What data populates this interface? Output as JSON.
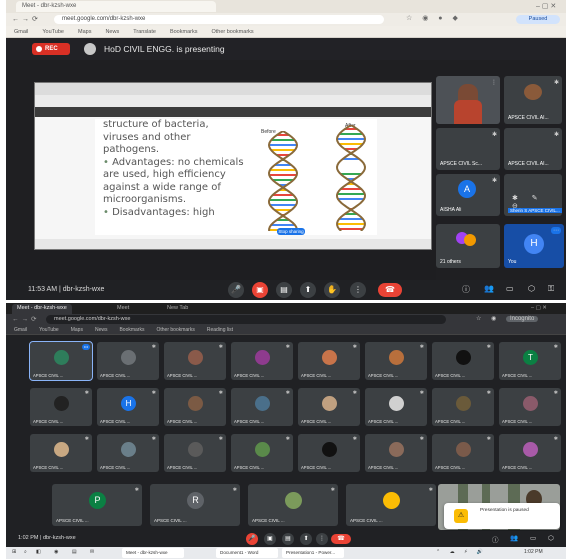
{
  "top": {
    "tab_title": "Meet - dbr-kzsh-wxe",
    "url": "meet.google.com/dbr-kzsh-wxe",
    "paused_label": "Paused",
    "bookmarks": [
      "Gmail",
      "YouTube",
      "Maps",
      "News",
      "Translate",
      "Bookmarks",
      "Other bookmarks"
    ],
    "rec_label": "REC",
    "presenting_text": "HoD CIVIL ENGG. is presenting",
    "slide": {
      "lines": [
        "structure of bacteria,",
        "viruses and other",
        "pathogens."
      ],
      "advantages": [
        "Advantages: no chemicals",
        "are used, high efficiency",
        "against a wide range of",
        "microorganisms."
      ],
      "disadvantages": "Disadvantages: high",
      "before_label": "Before",
      "after_label": "After",
      "stop_label": "Stop sharing"
    },
    "tiles": [
      {
        "name": ""
      },
      {
        "name": "APSCE CIVIL AI..."
      },
      {
        "name": "APSCE CIVIL Sc..."
      },
      {
        "name": "APSCE CIVIL AI..."
      },
      {
        "name": "AISHA Ali"
      },
      {
        "name": "Sherin S APSCE CIVIL..."
      },
      {
        "name": "21 others",
        "avatar_letter": "A"
      },
      {
        "name": "You",
        "avatar_letter": "H"
      }
    ],
    "call_time": "11:53 AM | dbr-kzsh-wxe",
    "avatar_letters": {
      "aisha": "A",
      "you": "H"
    }
  },
  "bottom": {
    "tabs": [
      "Meet - dbr-kzsh-wxe",
      "Meet",
      "New Tab"
    ],
    "url": "meet.google.com/dbr-kzsh-wxe",
    "incognito_label": "Incognito",
    "bookmarks": [
      "Gmail",
      "YouTube",
      "Maps",
      "News",
      "Bookmarks",
      "Other bookmarks",
      "Reading list"
    ],
    "grid": [
      {
        "name": "APSCE CIVIL ...",
        "letter": "",
        "color": "#2e7d5b"
      },
      {
        "name": "APSCE CIVIL ...",
        "letter": "",
        "color": "#6a6f73"
      },
      {
        "name": "APSCE CIVIL ...",
        "letter": "",
        "color": "#8a5a4a"
      },
      {
        "name": "APSCE CIVIL ...",
        "letter": "",
        "color": "#8e3b8e"
      },
      {
        "name": "APSCE CIVIL ...",
        "letter": "",
        "color": "#c8744a"
      },
      {
        "name": "APSCE CIVIL ...",
        "letter": "",
        "color": "#b86f3c"
      },
      {
        "name": "APSCE CIVIL ...",
        "letter": "",
        "color": "#111111"
      },
      {
        "name": "APSCE CIVIL ...",
        "letter": "T",
        "color": "#0b8043"
      },
      {
        "name": "APSCE CIVIL ...",
        "letter": "",
        "color": "#222222"
      },
      {
        "name": "APSCE CIVIL ...",
        "letter": "H",
        "color": "#1a73e8"
      },
      {
        "name": "APSCE CIVIL ...",
        "letter": "",
        "color": "#7b5a44"
      },
      {
        "name": "APSCE CIVIL ...",
        "letter": "",
        "color": "#4a6f8a"
      },
      {
        "name": "APSCE CIVIL ...",
        "letter": "",
        "color": "#c0a080"
      },
      {
        "name": "APSCE CIVIL ...",
        "letter": "",
        "color": "#d0d0d0"
      },
      {
        "name": "APSCE CIVIL ...",
        "letter": "",
        "color": "#6a5a3a"
      },
      {
        "name": "APSCE CIVIL ...",
        "letter": "",
        "color": "#8a5a6a"
      },
      {
        "name": "APSCE CIVIL ...",
        "letter": "",
        "color": "#c8a882"
      },
      {
        "name": "APSCE CIVIL ...",
        "letter": "",
        "color": "#6a7f8a"
      },
      {
        "name": "APSCE CIVIL ...",
        "letter": "",
        "color": "#5a5a5a"
      },
      {
        "name": "APSCE CIVIL ...",
        "letter": "",
        "color": "#5a8a4a"
      },
      {
        "name": "APSCE CIVIL ...",
        "letter": "",
        "color": "#111111"
      },
      {
        "name": "APSCE CIVIL ...",
        "letter": "",
        "color": "#8a6a5a"
      },
      {
        "name": "APSCE CIVIL ...",
        "letter": "",
        "color": "#7a5a4a"
      },
      {
        "name": "APSCE CIVIL ...",
        "letter": "",
        "color": "#a85aa8"
      }
    ],
    "wide": [
      {
        "name": "APSCE CIVIL ...",
        "letter": "P",
        "color": "#0b8043"
      },
      {
        "name": "APSCE CIVIL ...",
        "letter": "R",
        "color": "#5f6368"
      },
      {
        "name": "APSCE CIVIL ...",
        "letter": "",
        "color": "#7b9a5b"
      },
      {
        "name": "APSCE CIVIL ...",
        "letter": "",
        "color": "#fbbc04"
      }
    ],
    "toast_text": "Presentation is paused",
    "call_time": "1:02 PM | dbr-kzsh-wxe",
    "taskbar_apps": [
      "Meet - dbr-kzsh-wxe",
      "Document1 - Word",
      "Presentation1 - Power..."
    ],
    "clock": "1:02 PM"
  },
  "colors": {
    "meet_dark": "#202124",
    "tile": "#3c4043",
    "rec_red": "#d93025",
    "end_red": "#ea4335",
    "blue": "#1a73e8"
  }
}
